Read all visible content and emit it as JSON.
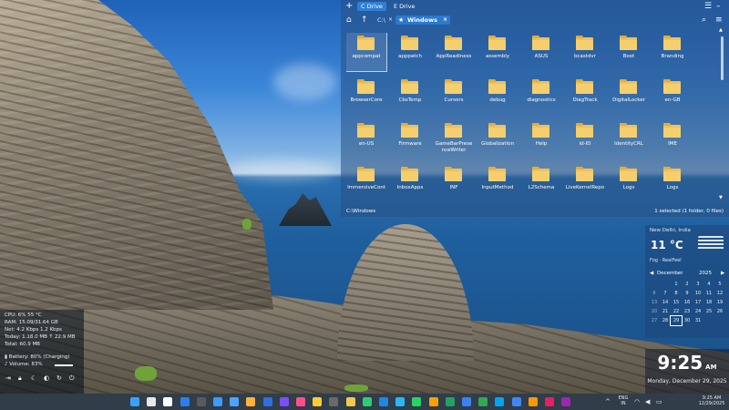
{
  "explorer": {
    "tabs": [
      "C Drive",
      "E Drive"
    ],
    "breadcrumb_root": "C:\\",
    "current_folder": "Windows",
    "items": [
      "appcompat",
      "apppatch",
      "AppReadiness",
      "assembly",
      "ASUS",
      "bcastdvr",
      "Boot",
      "Branding",
      "BrowserCore",
      "CbsTemp",
      "Cursors",
      "debug",
      "diagnostics",
      "DiagTrack",
      "DigitalLocker",
      "en-GB",
      "en-US",
      "Firmware",
      "GameBarPresenceWriter",
      "Globalization",
      "Help",
      "id-ID",
      "IdentityCRL",
      "IME",
      "ImmersiveControlPanel",
      "InboxApps",
      "INF",
      "InputMethod",
      "L2Schema",
      "LiveKernelReports",
      "Logs",
      "Logs"
    ],
    "selected_item": "appcompat",
    "status_left": "C:\\Windows",
    "status_right": "1 selected (1 folder, 0 files)"
  },
  "widget": {
    "location": "New Delhi, India",
    "temperature": "11 °C",
    "description": "Fog · RealFeel",
    "month": "December",
    "year": "2025",
    "days": [
      "",
      "",
      "1",
      "2",
      "3",
      "4",
      "5",
      "6",
      "7",
      "8",
      "9",
      "10",
      "11",
      "12",
      "13",
      "14",
      "15",
      "16",
      "17",
      "18",
      "19",
      "20",
      "21",
      "22",
      "23",
      "24",
      "25",
      "26",
      "27",
      "28",
      "29",
      "30",
      "31",
      "",
      ""
    ],
    "today": "29"
  },
  "clock": {
    "time": "9:25",
    "ampm": "AM",
    "date": "Monday, December 29, 2025"
  },
  "sysmon": {
    "cpu": "CPU: 6%  55 °C",
    "ram": "RAM: 15.09/31.64 GB",
    "net": "Net: 4.2 Kbps 1.2 Kbps",
    "today": "Today: 1.18.0 MB ↑ 22.9 MB",
    "total": "Total: 60.9 MB",
    "battery": "Battery: 80% (Charging)",
    "volume": "Volume: 83%"
  },
  "tray": {
    "lang": "ENG",
    "region": "IN",
    "time": "9:25 AM",
    "date": "12/29/2025"
  },
  "colors": {
    "accent": "#2f7fd6",
    "folder": "#f5cf6e"
  },
  "taskbar_apps": [
    "#3aa0ff",
    "#e8e8e8",
    "#ffffff",
    "#2d7df0",
    "#5a5a5a",
    "#3d9bff",
    "#4fa3ff",
    "#ffb13b",
    "#2f6fe0",
    "#7c4dff",
    "#ff4f8b",
    "#ffcc33",
    "#6a6a6a",
    "#f2c94c",
    "#2ecc71",
    "#1e88e5",
    "#29b6f6",
    "#25d366",
    "#ffa000",
    "#1fa463",
    "#3b82f6",
    "#34a853",
    "#00a4ef",
    "#4285f4",
    "#ff9800",
    "#e91e63",
    "#9c27b0"
  ]
}
